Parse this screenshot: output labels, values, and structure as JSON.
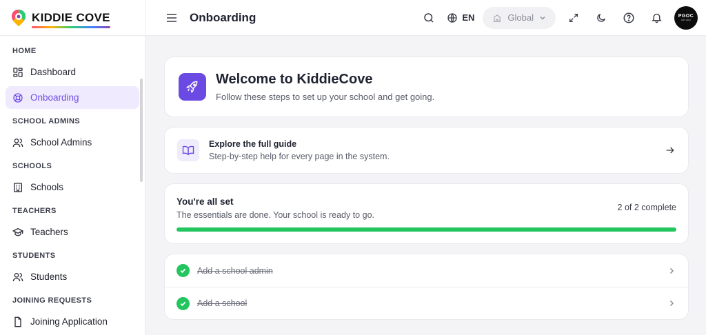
{
  "brand": {
    "name": "KIDDIE COVE"
  },
  "sidebar": {
    "sections": [
      {
        "label": "HOME",
        "items": [
          {
            "label": "Dashboard",
            "icon": "grid-icon"
          },
          {
            "label": "Onboarding",
            "icon": "lifebuoy-icon",
            "active": true
          }
        ]
      },
      {
        "label": "SCHOOL ADMINS",
        "items": [
          {
            "label": "School Admins",
            "icon": "users-icon"
          }
        ]
      },
      {
        "label": "SCHOOLS",
        "items": [
          {
            "label": "Schools",
            "icon": "building-icon"
          }
        ]
      },
      {
        "label": "TEACHERS",
        "items": [
          {
            "label": "Teachers",
            "icon": "graduation-cap-icon"
          }
        ]
      },
      {
        "label": "STUDENTS",
        "items": [
          {
            "label": "Students",
            "icon": "users-icon"
          }
        ]
      },
      {
        "label": "JOINING REQUESTS",
        "items": [
          {
            "label": "Joining Application",
            "icon": "file-icon"
          }
        ]
      }
    ]
  },
  "topbar": {
    "title": "Onboarding",
    "language": "EN",
    "scope": "Global",
    "avatar": {
      "line1": "PGOC",
      "line2": "EST 2024"
    }
  },
  "welcome": {
    "title": "Welcome to KiddieCove",
    "subtitle": "Follow these steps to set up your school and get going."
  },
  "guide": {
    "title": "Explore the full guide",
    "subtitle": "Step-by-step help for every page in the system."
  },
  "progress": {
    "title": "You're all set",
    "subtitle": "The essentials are done. Your school is ready to go.",
    "count_text": "2 of 2 complete",
    "fraction": 1.0
  },
  "steps": [
    {
      "label": "Add a school admin",
      "done": true
    },
    {
      "label": "Add a school",
      "done": true
    }
  ],
  "colors": {
    "accent": "#6b49e3",
    "success": "#22c55e",
    "active_bg": "#efeafd"
  }
}
